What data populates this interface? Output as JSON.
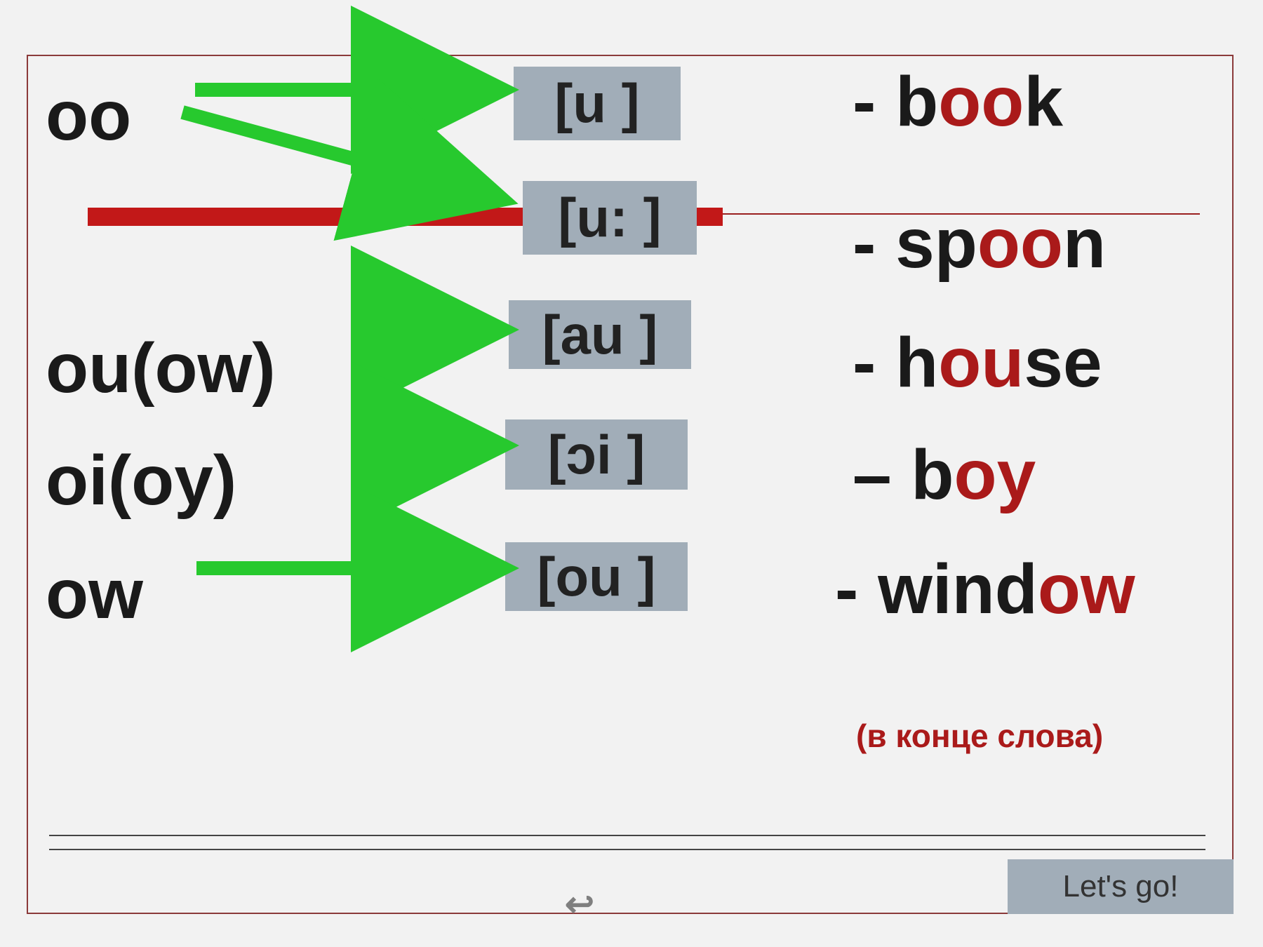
{
  "rows": {
    "r1": {
      "letters": "oo",
      "ipa": "[u ]",
      "dash": "-",
      "pre": "b",
      "mid": "oo",
      "post": "k"
    },
    "r1b": {
      "ipa": "[u: ]",
      "dash": "-",
      "pre": "sp",
      "mid": "oo",
      "post": "n"
    },
    "r2": {
      "letters": "ou(ow)",
      "ipa": "[au ]",
      "dash": "-",
      "pre": "h",
      "mid": "ou",
      "post": "se"
    },
    "r3": {
      "letters": "oi(oy)",
      "ipa": "[ɔi ]",
      "dash": "–",
      "pre": "b",
      "mid": "oy",
      "post": ""
    },
    "r4": {
      "letters": "ow",
      "ipa": "[ou ]",
      "dash": "-",
      "pre": "wind",
      "mid": "ow",
      "post": ""
    }
  },
  "note": "(в конце слова)",
  "button": "Let's go!",
  "icon": "↩",
  "colors": {
    "arrow": "#27c92e",
    "box": "#a1adb8",
    "highlight": "#aa1a1a",
    "redbar": "#c21818"
  }
}
